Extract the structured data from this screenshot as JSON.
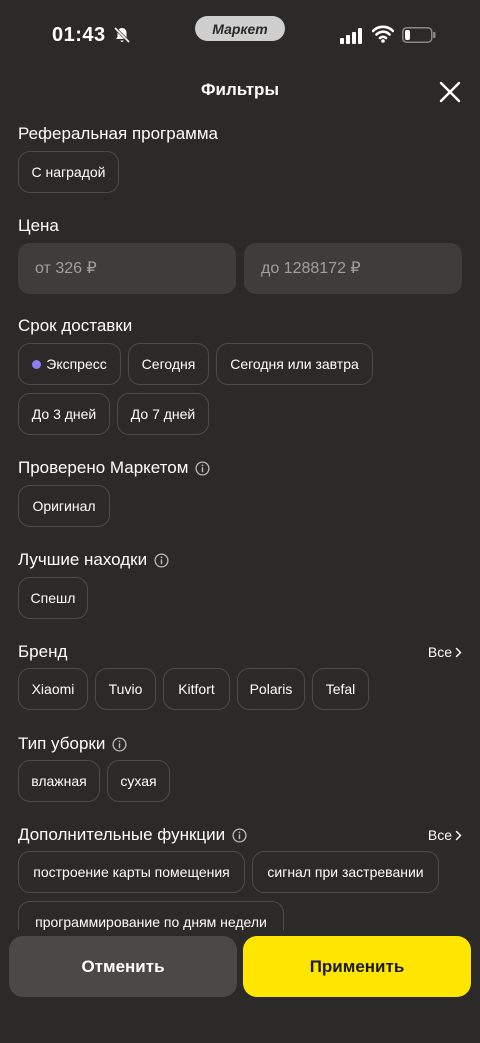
{
  "status_bar": {
    "time": "01:43",
    "app_pill": "Маркет"
  },
  "header": {
    "title": "Фильтры"
  },
  "referral": {
    "title": "Реферальная программа",
    "chips": [
      "С наградой"
    ]
  },
  "price": {
    "title": "Цена",
    "from_placeholder": "от 326 ₽",
    "to_placeholder": "до 1288172 ₽"
  },
  "delivery": {
    "title": "Срок доставки",
    "chips": [
      "Экспресс",
      "Сегодня",
      "Сегодня или завтра",
      "До 3 дней",
      "До 7 дней"
    ]
  },
  "verified": {
    "title": "Проверено Маркетом",
    "chips": [
      "Оригинал"
    ]
  },
  "best_finds": {
    "title": "Лучшие находки",
    "chips": [
      "Спешл"
    ]
  },
  "brand": {
    "title": "Бренд",
    "all_label": "Все",
    "chips": [
      "Xiaomi",
      "Tuvio",
      "Kitfort",
      "Polaris",
      "Tefal"
    ]
  },
  "cleaning_type": {
    "title": "Тип уборки",
    "chips": [
      "влажная",
      "сухая"
    ]
  },
  "extra_functions": {
    "title": "Дополнительные функции",
    "all_label": "Все",
    "chips": [
      "построение карты помещения",
      "сигнал при застревании",
      "программирование по дням недели"
    ]
  },
  "actions": {
    "cancel_label": "Отменить",
    "apply_label": "Применить"
  },
  "colors": {
    "background": "#2b2a29",
    "accent_yellow": "#ffe600",
    "express_dot": "#8c7cf5"
  }
}
